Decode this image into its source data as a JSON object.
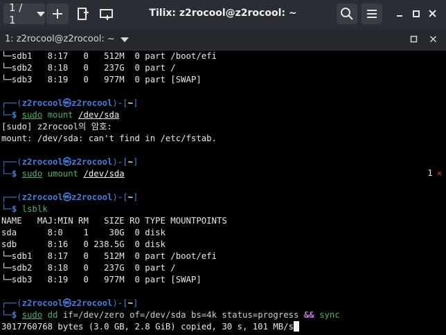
{
  "window": {
    "session_selector": "1 / 1",
    "title": "Tilix: z2rocool@z2rocool: ~"
  },
  "terminal": {
    "tab_title": "1: z2rocool@z2rocool: ~"
  },
  "lines": {
    "l1": [
      "└─sdb1   8:17   0   512M  0 part /boot/efi"
    ],
    "l2": "└─sdb2   8:18   0   237G  0 part /",
    "l3": "└─sdb3   8:19   0   977M  0 part [SWAP]",
    "p1_user": "z2rocool",
    "p1_host": "z2rocool",
    "p1_dir": "~",
    "c1_sudo": "sudo",
    "c1_cmd": "mount",
    "c1_arg": "/dev/sda",
    "o1": "[sudo] z2rocool의 암호:",
    "o2": "mount: /dev/sda: can't find in /etc/fstab.",
    "p2_user": "z2rocool",
    "p2_host": "z2rocool",
    "p2_dir": "~",
    "c2_sudo": "sudo",
    "c2_cmd": "umount",
    "c2_arg": "/dev/sda",
    "exit_code": "1",
    "exit_mark": "✕",
    "p3_user": "z2rocool",
    "p3_host": "z2rocool",
    "p3_dir": "~",
    "c3_cmd": "lsblk",
    "h1": "NAME   MAJ:MIN RM   SIZE RO TYPE MOUNTPOINTS",
    "r1": "sda      8:0    1    30G  0 disk",
    "r2": "sdb      8:16   0 238.5G  0 disk",
    "r3": "└─sdb1   8:17   0   512M  0 part /boot/efi",
    "r4": "└─sdb2   8:18   0   237G  0 part /",
    "r5": "└─sdb3   8:19   0   977M  0 part [SWAP]",
    "p4_user": "z2rocool",
    "p4_host": "z2rocool",
    "p4_dir": "~",
    "c4_sudo": "sudo",
    "c4_cmd": "dd",
    "c4_args1": "if=/dev/zero of=/dev/sda bs=4k status=progress",
    "c4_and": "&&",
    "c4_sync": "sync",
    "o3": "3017760768 bytes (3.0 GB, 2.8 GiB) copied, 30 s, 101 MB/s"
  },
  "glyphs": {
    "prompt_top_left": "┌──(",
    "prompt_at": "㉿",
    "prompt_mid": ")-[",
    "prompt_end": "]",
    "prompt_bottom": "└─",
    "prompt_dollar": "$"
  }
}
